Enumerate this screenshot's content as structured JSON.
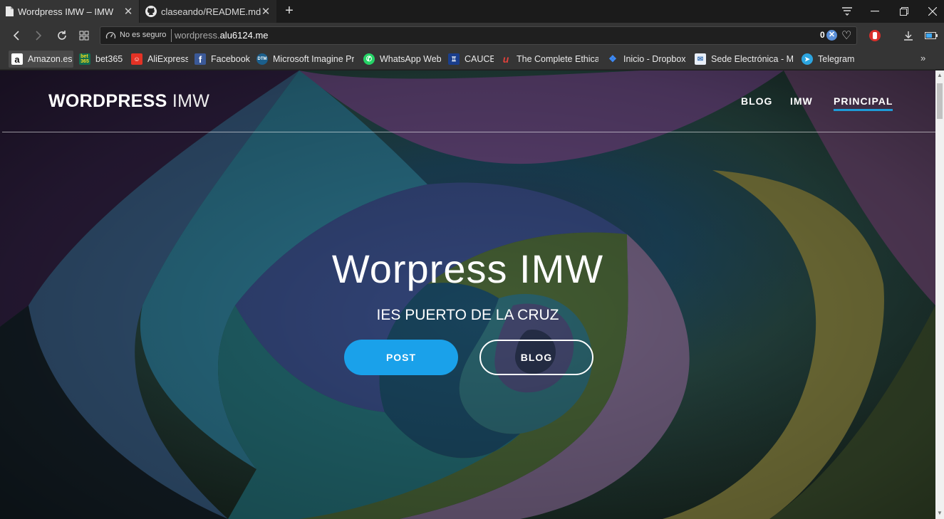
{
  "browser": {
    "tabs": [
      {
        "title": "Wordpress IMW – IMW",
        "active": true,
        "icon": "page-icon"
      },
      {
        "title": "claseando/README.md at",
        "active": false,
        "icon": "github-icon"
      }
    ],
    "address": {
      "security_label": "No es seguro",
      "url_prefix": "wordpress.",
      "url_host": "alu6124.me",
      "blocked_count": "0"
    },
    "bookmarks": [
      {
        "label": "Amazon.es",
        "icon": "amazon-icon",
        "color": "#232f3e",
        "glyph": "a"
      },
      {
        "label": "bet365",
        "icon": "bet365-icon",
        "color": "#126e51",
        "glyph": "bet"
      },
      {
        "label": "AliExpress",
        "icon": "aliexpress-icon",
        "color": "#e43225",
        "glyph": "A"
      },
      {
        "label": "Facebook",
        "icon": "facebook-icon",
        "color": "#3b5998",
        "glyph": "f"
      },
      {
        "label": "Microsoft Imagine Pr",
        "icon": "microsoft-icon",
        "color": "#1b5f8c",
        "glyph": "ms"
      },
      {
        "label": "WhatsApp Web",
        "icon": "whatsapp-icon",
        "color": "#25d366",
        "glyph": "w"
      },
      {
        "label": "CAUCE",
        "icon": "cauce-icon",
        "color": "#1a3e8c",
        "glyph": "C"
      },
      {
        "label": "The Complete Ethical",
        "icon": "udemy-icon",
        "color": "#b52b2b",
        "glyph": "u"
      },
      {
        "label": "Inicio - Dropbox",
        "icon": "dropbox-icon",
        "color": "#0061fe",
        "glyph": "◆"
      },
      {
        "label": "Sede Electrónica - Mi",
        "icon": "sede-icon",
        "color": "#3a72b5",
        "glyph": "S"
      },
      {
        "label": "Telegram",
        "icon": "telegram-icon",
        "color": "#2ca5e0",
        "glyph": "➤"
      }
    ]
  },
  "site": {
    "title_strong": "WORDPRESS",
    "title_light": "IMW",
    "menu": [
      {
        "label": "BLOG",
        "current": false
      },
      {
        "label": "IMW",
        "current": false
      },
      {
        "label": "PRINCIPAL",
        "current": true
      }
    ],
    "hero": {
      "title": "Worpress IMW",
      "subtitle": "IES PUERTO DE LA CRUZ",
      "primary_button": "POST",
      "secondary_button": "BLOG"
    },
    "colors": {
      "accent": "#1aa1ea",
      "underline": "#1e9bd7"
    }
  }
}
